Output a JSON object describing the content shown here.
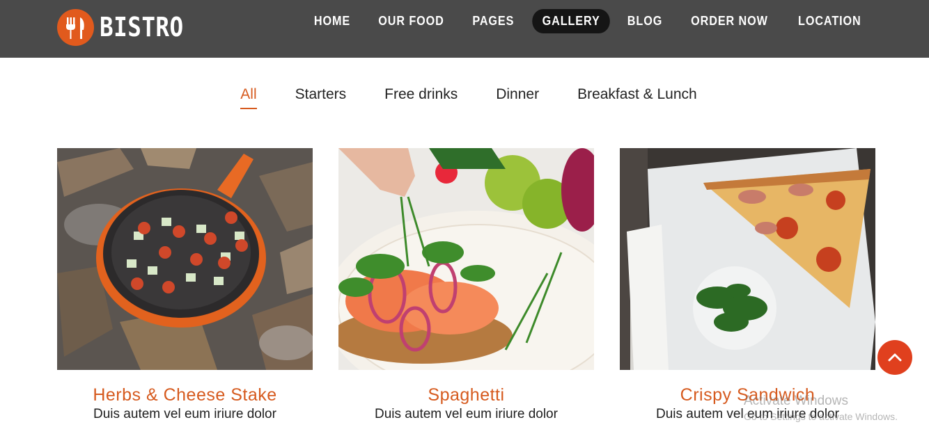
{
  "brand": {
    "name": "BISTRO",
    "logo_icon": "fork-knife-icon",
    "accent": "#e15a1d"
  },
  "nav": {
    "items": [
      {
        "label": "HOME",
        "active": false
      },
      {
        "label": "OUR FOOD",
        "active": false
      },
      {
        "label": "PAGES",
        "active": false
      },
      {
        "label": "GALLERY",
        "active": true
      },
      {
        "label": "BLOG",
        "active": false
      },
      {
        "label": "ORDER NOW",
        "active": false
      },
      {
        "label": "LOCATION",
        "active": false
      }
    ],
    "background": "#4a4a4a",
    "active_background": "#151515"
  },
  "filters": {
    "items": [
      {
        "label": "All",
        "active": true
      },
      {
        "label": "Starters",
        "active": false
      },
      {
        "label": "Free drinks",
        "active": false
      },
      {
        "label": "Dinner",
        "active": false
      },
      {
        "label": "Breakfast & Lunch",
        "active": false
      }
    ],
    "active_color": "#d65a1e"
  },
  "gallery": {
    "items": [
      {
        "title": "Herbs & Cheese Stake",
        "description": "Duis autem vel eum iriure dolor",
        "image": "skillet-on-campfire-photo"
      },
      {
        "title": "Spaghetti",
        "description": "Duis autem vel eum iriure dolor",
        "image": "salmon-salad-plate-photo"
      },
      {
        "title": "Crispy Sandwich",
        "description": "Duis autem vel eum iriure dolor",
        "image": "pizza-slice-plate-photo"
      }
    ],
    "title_color": "#d65a1e"
  },
  "scroll_top": {
    "icon": "chevron-up-icon",
    "color": "#e0401e"
  },
  "watermark": {
    "title": "Activate Windows",
    "subtitle": "Go to Settings to activate Windows."
  }
}
